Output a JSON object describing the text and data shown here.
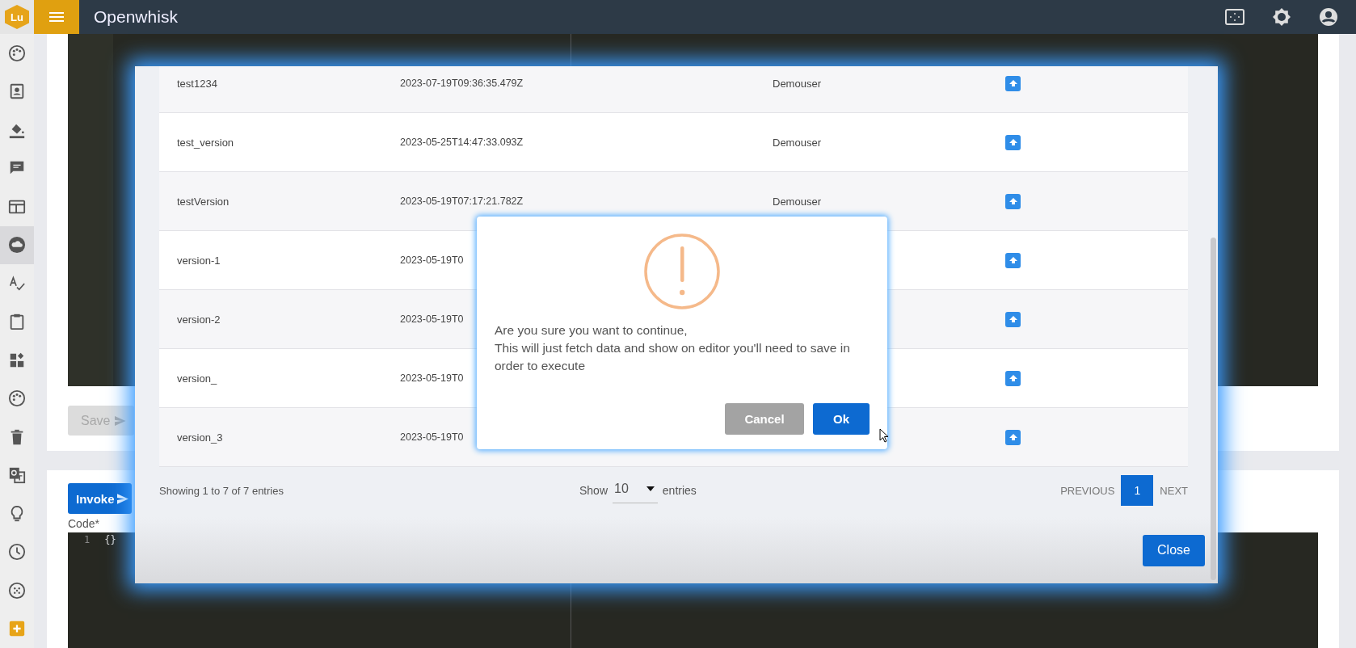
{
  "app": {
    "logo": "Lu",
    "title": "Openwhisk"
  },
  "sidebar": {
    "items": [
      {
        "selected": false
      },
      {
        "selected": false
      },
      {
        "selected": false
      },
      {
        "selected": false
      },
      {
        "selected": false
      },
      {
        "selected": true
      },
      {
        "selected": false
      },
      {
        "selected": false
      },
      {
        "selected": false
      },
      {
        "selected": false
      },
      {
        "selected": false
      },
      {
        "selected": false
      },
      {
        "selected": false
      },
      {
        "selected": false
      },
      {
        "selected": false
      },
      {
        "selected": false
      }
    ]
  },
  "editor_card": {
    "save_button": {
      "label": "Save",
      "disabled": true
    }
  },
  "invoke_card": {
    "invoke_button": "Invoke",
    "code_label": "Code*",
    "code_lines": [
      {
        "number": "1",
        "text": "{}"
      }
    ]
  },
  "versions_modal": {
    "rows": [
      {
        "name": "test1234",
        "date": "2023-07-19T09:36:35.479Z",
        "user": "Demouser"
      },
      {
        "name": "test_version",
        "date": "2023-05-25T14:47:33.093Z",
        "user": "Demouser"
      },
      {
        "name": "testVersion",
        "date": "2023-05-19T07:17:21.782Z",
        "user": "Demouser"
      },
      {
        "name": "version-1",
        "date": "2023-05-19T0"
      },
      {
        "name": "version-2",
        "date": "2023-05-19T0"
      },
      {
        "name": "version_",
        "date": "2023-05-19T0"
      },
      {
        "name": "version_3",
        "date": "2023-05-19T0"
      }
    ],
    "summary": "Showing 1 to 7 of 7 entries",
    "page_size": {
      "prefix": "Show",
      "value": "10",
      "suffix": "entries"
    },
    "pagination": {
      "previous": "PREVIOUS",
      "next": "NEXT",
      "pages": [
        {
          "label": "1",
          "selected": true
        }
      ]
    },
    "close_button": "Close"
  },
  "confirm_dialog": {
    "message": "Are you sure you want to continue,\nThis will just fetch data and show on editor you'll need to save in order to execute",
    "cancel_button": "Cancel",
    "ok_button": "Ok"
  }
}
